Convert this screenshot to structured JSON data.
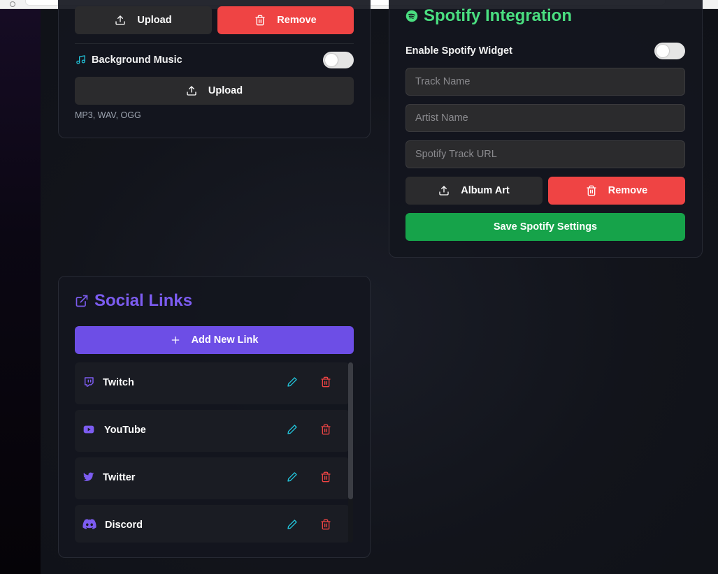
{
  "media_card": {
    "upload_label": "Upload",
    "remove_label": "Remove",
    "background_music_label": "Background Music",
    "music_upload_label": "Upload",
    "formats_hint": "MP3, WAV, OGG"
  },
  "spotify": {
    "title": "Spotify Integration",
    "enable_label": "Enable Spotify Widget",
    "track_placeholder": "Track Name",
    "artist_placeholder": "Artist Name",
    "url_placeholder": "Spotify Track URL",
    "album_art_label": "Album Art",
    "remove_label": "Remove",
    "save_label": "Save Spotify Settings"
  },
  "social": {
    "title": "Social Links",
    "add_label": "Add New Link",
    "links": [
      {
        "name": "Twitch",
        "icon": "twitch-icon"
      },
      {
        "name": "YouTube",
        "icon": "youtube-icon"
      },
      {
        "name": "Twitter",
        "icon": "twitter-icon"
      },
      {
        "name": "Discord",
        "icon": "discord-icon"
      }
    ]
  },
  "colors": {
    "accent_purple": "#6d4ee6",
    "spotify_green": "#22c55e",
    "danger_red": "#ef4444",
    "save_green": "#16a34a",
    "edit_cyan": "#22c3d9"
  }
}
